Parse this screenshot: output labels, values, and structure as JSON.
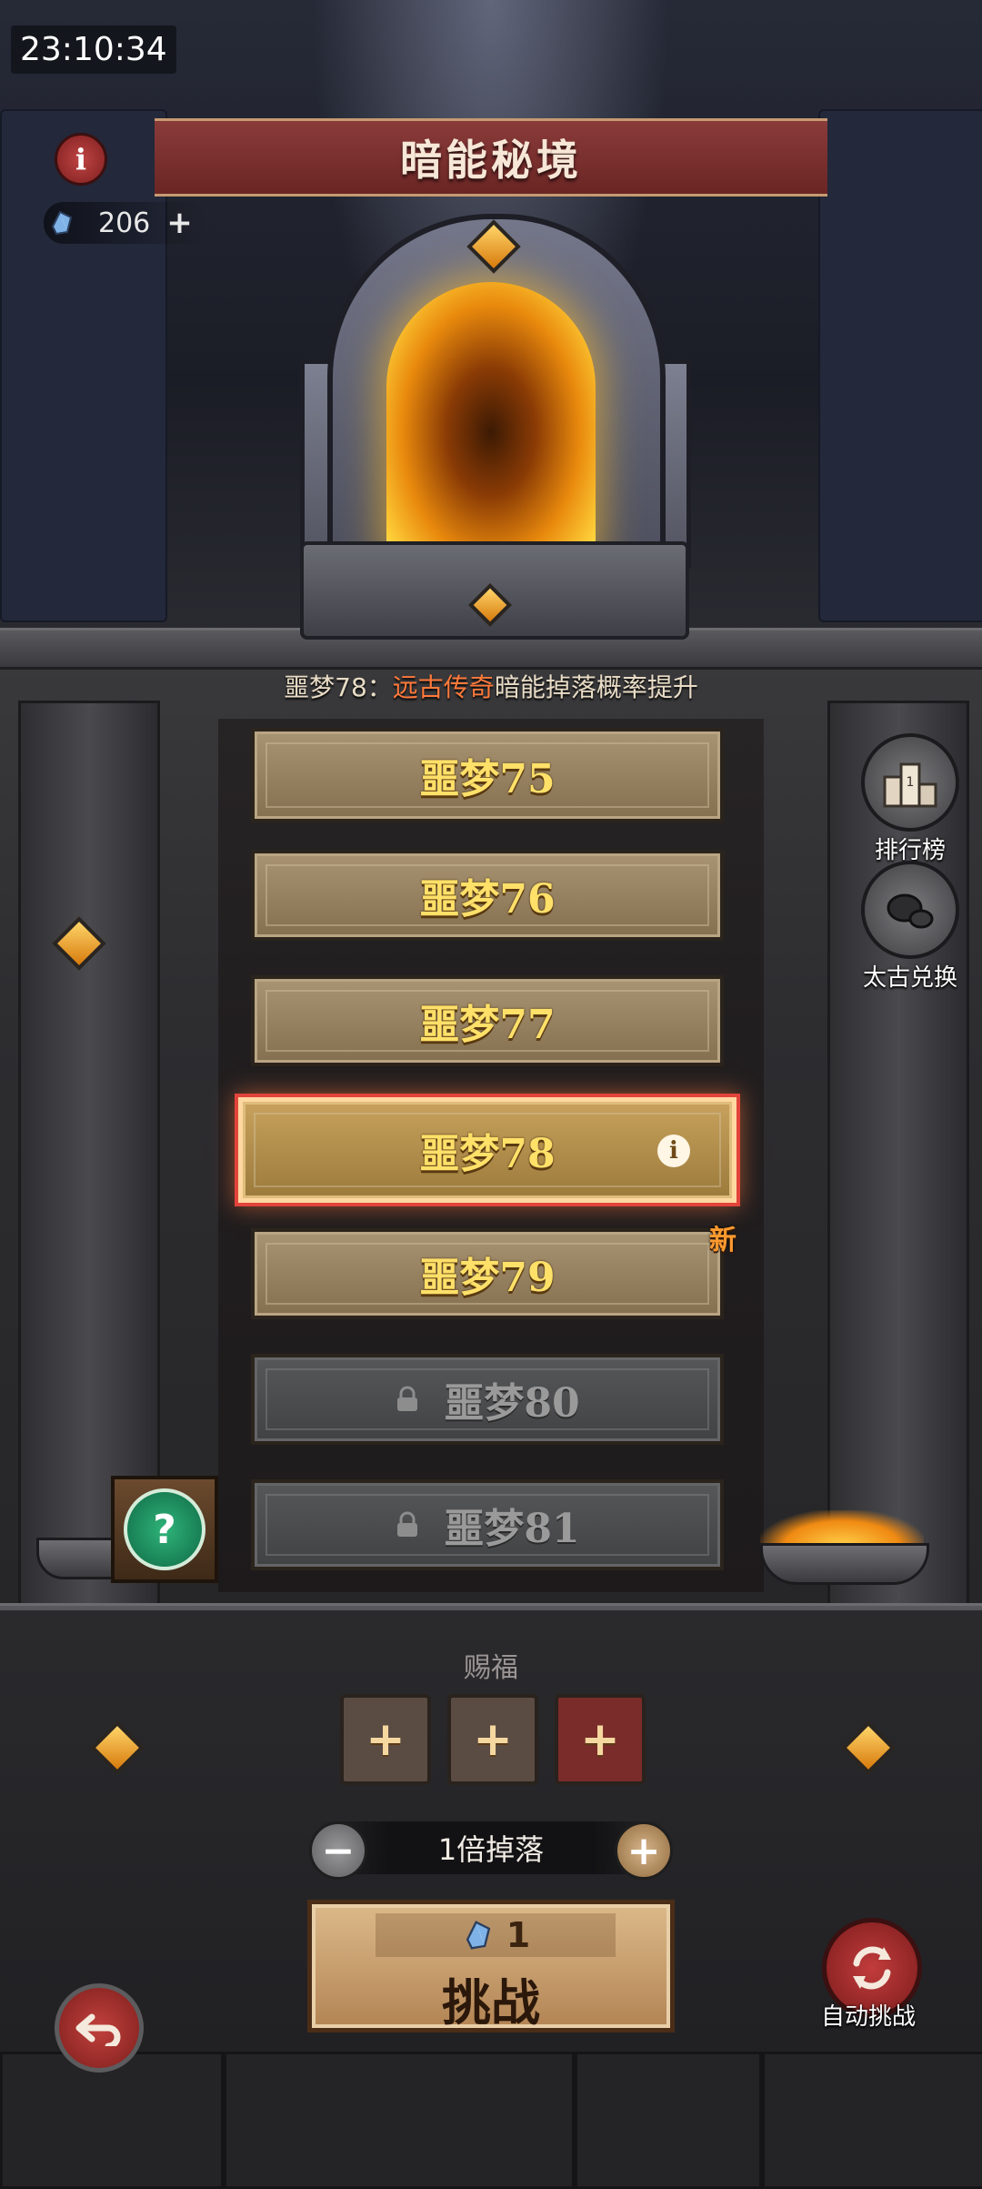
{
  "status_bar": {
    "time": "23:10:34"
  },
  "header": {
    "title": "暗能秘境",
    "currency": {
      "icon": "blue-crystal-icon",
      "amount": "206"
    }
  },
  "boost": {
    "prefix": "噩梦78：",
    "highlight": "远古传奇",
    "suffix": "暗能掉落概率提升"
  },
  "stages": [
    {
      "label": "噩梦75",
      "state": "unlocked"
    },
    {
      "label": "噩梦76",
      "state": "unlocked"
    },
    {
      "label": "噩梦77",
      "state": "unlocked"
    },
    {
      "label": "噩梦78",
      "state": "selected"
    },
    {
      "label": "噩梦79",
      "state": "unlocked",
      "badge": "新"
    },
    {
      "label": "噩梦80",
      "state": "locked"
    },
    {
      "label": "噩梦81",
      "state": "locked"
    }
  ],
  "side_buttons": {
    "ranking": "排行榜",
    "exchange": "太古兑换"
  },
  "blessing": {
    "title": "赐福",
    "slots": 3
  },
  "drop": {
    "label": "1倍掉落"
  },
  "challenge": {
    "cost": "1",
    "label": "挑战"
  },
  "auto_challenge": {
    "label": "自动挑战"
  },
  "colors": {
    "highlight": "#ff7a3b",
    "stage_text": "#ffe069",
    "selected_border": "#e2433b",
    "banner": "#7a2f2d"
  }
}
